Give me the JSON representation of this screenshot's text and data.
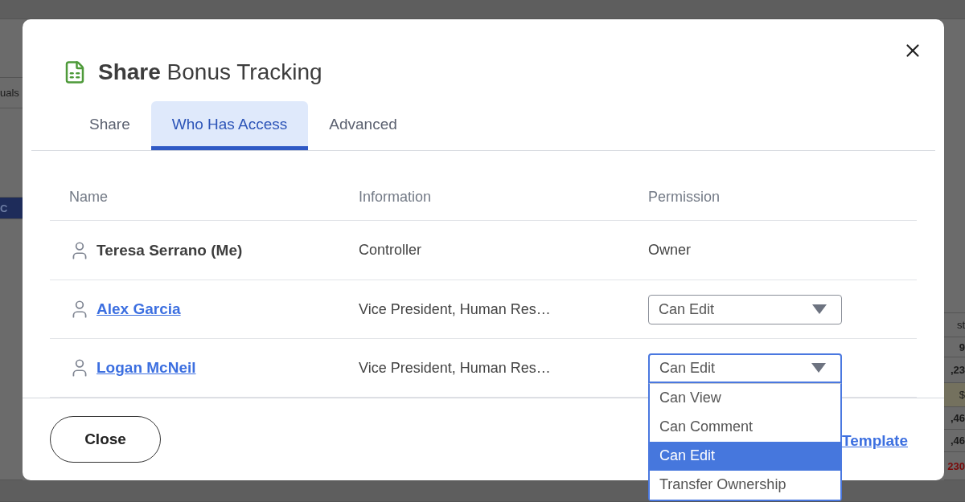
{
  "background": {
    "left": [
      {
        "text": "uals",
        "kind": "plain"
      },
      {
        "text": "C",
        "kind": "header"
      }
    ],
    "right": [
      {
        "text": "st",
        "kind": "plain"
      },
      {
        "text": "9",
        "kind": "number"
      },
      {
        "text": ",23",
        "kind": "number"
      },
      {
        "text": "$",
        "kind": "highlight"
      },
      {
        "text": ",46",
        "kind": "number"
      },
      {
        "text": ",46",
        "kind": "number"
      },
      {
        "text": "230",
        "kind": "negative"
      }
    ]
  },
  "dialog": {
    "title": "**Share** Bonus Tracking",
    "tabs": [
      {
        "label": "Share",
        "selected": false
      },
      {
        "label": "Who Has Access",
        "selected": true
      },
      {
        "label": "Advanced",
        "selected": false
      }
    ],
    "table": {
      "columns": [
        "Name",
        "Information",
        "Permission"
      ],
      "rows": [
        {
          "name": "Teresa Serrano (Me)",
          "kind": "text",
          "information": "Controller",
          "permission": {
            "kind": "text",
            "value": "Owner"
          }
        },
        {
          "name": "Alex Garcia",
          "kind": "link",
          "information": "Vice President, Human Res…",
          "permission": {
            "kind": "select",
            "value": "Can Edit",
            "expanded": false
          }
        },
        {
          "name": "Logan McNeil",
          "kind": "link",
          "information": "Vice President, Human Res…",
          "permission": {
            "kind": "select",
            "value": "Can Edit",
            "expanded": true,
            "options": [
              {
                "label": "Can View",
                "selected": false
              },
              {
                "label": "Can Comment",
                "selected": false
              },
              {
                "label": "Can Edit",
                "selected": true
              },
              {
                "label": "Transfer Ownership",
                "selected": false
              }
            ]
          }
        }
      ]
    },
    "footer": {
      "close_button": "Close",
      "link": "Template"
    }
  }
}
